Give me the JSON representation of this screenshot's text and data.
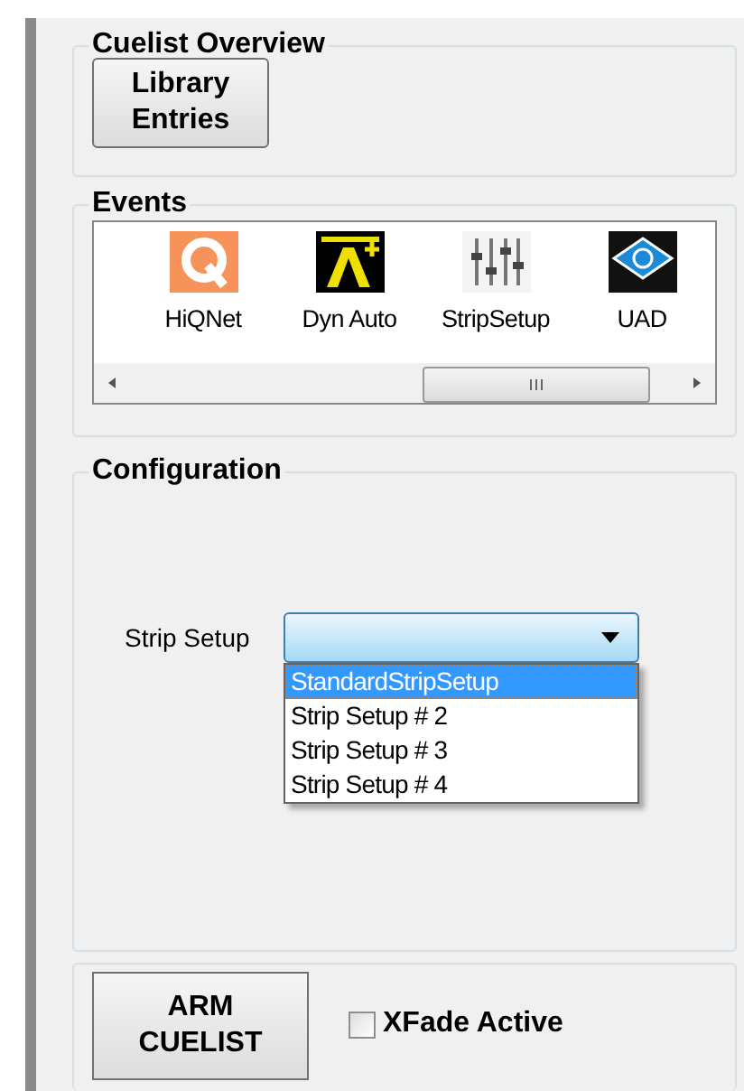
{
  "cuelist_overview": {
    "title": "Cuelist Overview",
    "button": "Library Entries"
  },
  "events": {
    "title": "Events",
    "items": [
      {
        "kind": "hiqnet",
        "label": "HiQNet"
      },
      {
        "kind": "dyn-auto",
        "label": "Dyn Auto"
      },
      {
        "kind": "strip-setup",
        "label": "StripSetup"
      },
      {
        "kind": "uad",
        "label": "UAD"
      }
    ]
  },
  "configuration": {
    "title": "Configuration",
    "label": "Strip Setup",
    "dropdown": {
      "expanded": true,
      "options": [
        {
          "label": "StandardStripSetup",
          "selected": true
        },
        {
          "label": "Strip Setup # 2",
          "selected": false
        },
        {
          "label": "Strip Setup # 3",
          "selected": false
        },
        {
          "label": "Strip Setup # 4",
          "selected": false
        }
      ]
    }
  },
  "footer": {
    "button": "ARM CUELIST",
    "checkbox": {
      "label": "XFade Active",
      "checked": false
    }
  }
}
